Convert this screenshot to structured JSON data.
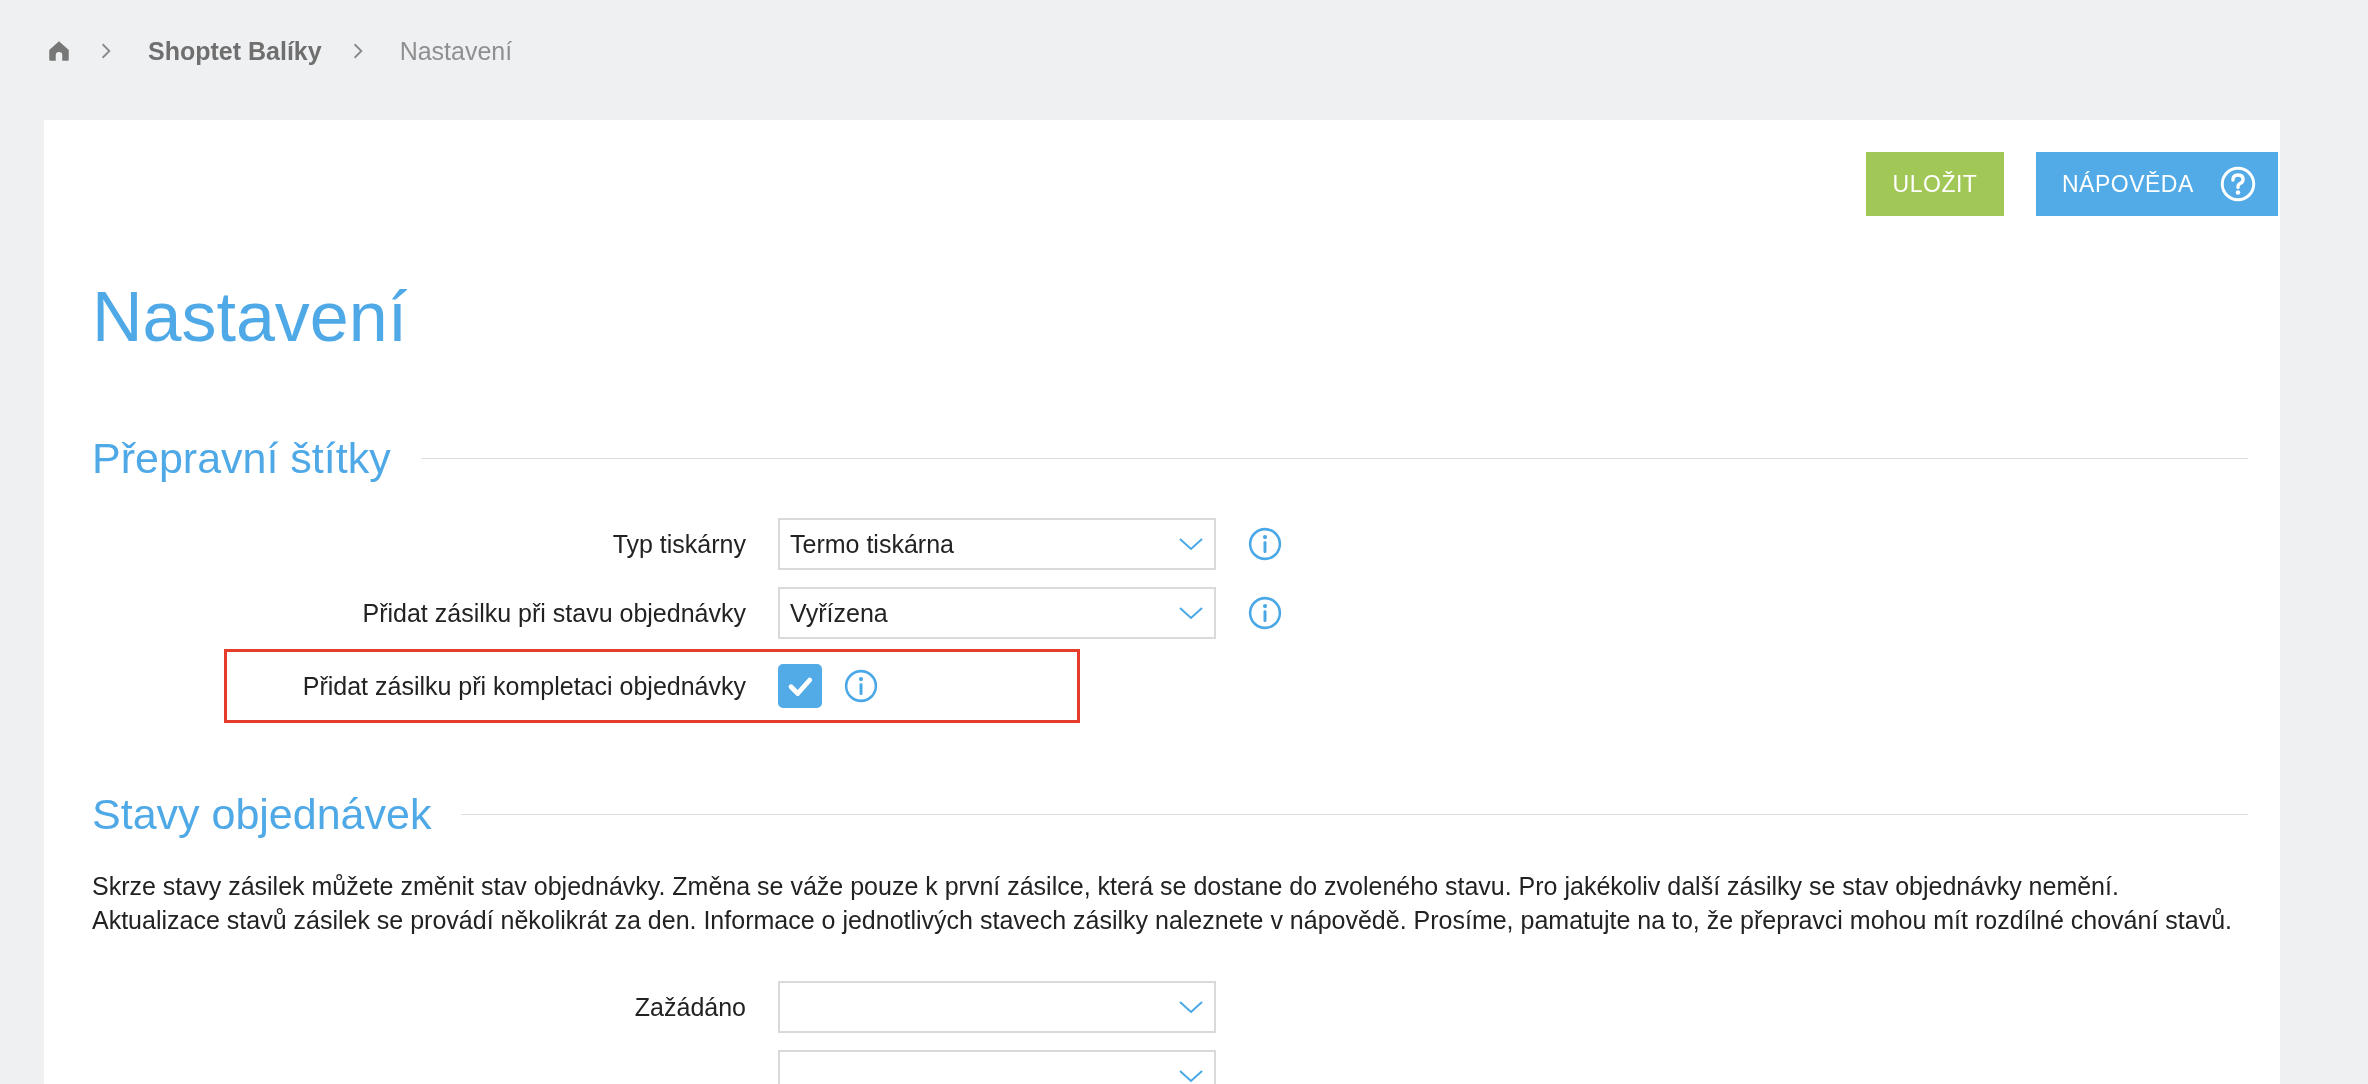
{
  "breadcrumb": [
    {
      "label": "Shoptet Balíky",
      "current": false
    },
    {
      "label": "Nastavení",
      "current": true
    }
  ],
  "buttons": [
    {
      "label": "ULOŽIT",
      "kind": "save"
    },
    {
      "label": "NÁPOVĚDA",
      "kind": "help"
    }
  ],
  "title": "Nastavení",
  "sections": [
    {
      "heading": "Přepravní štítky",
      "fields": [
        {
          "kind": "select",
          "label": "Typ tiskárny",
          "value": "Termo tiskárna",
          "info": true,
          "highlighted": false
        },
        {
          "kind": "select",
          "label": "Přidat zásilku při stavu objednávky",
          "value": "Vyřízena",
          "info": true,
          "highlighted": false
        },
        {
          "kind": "checkbox",
          "label": "Přidat zásilku při kompletaci objednávky",
          "checked": true,
          "info": true,
          "highlighted": true
        }
      ]
    },
    {
      "heading": "Stavy objednávek",
      "description": "Skrze stavy zásilek můžete změnit stav objednávky. Změna se váže pouze k první zásilce, která se dostane do zvoleného stavu. Pro jakékoliv další zásilky se stav objednávky nemění. Aktualizace stavů zásilek se provádí několikrát za den. Informace o jednotlivých stavech zásilky naleznete v nápovědě. Prosíme, pamatujte na to, že přepravci mohou mít rozdílné chování stavů.",
      "fields": [
        {
          "kind": "select",
          "label": "Zažádáno",
          "info": false,
          "highlighted": false
        },
        {
          "kind": "select",
          "info": false,
          "highlighted": false
        }
      ]
    }
  ]
}
